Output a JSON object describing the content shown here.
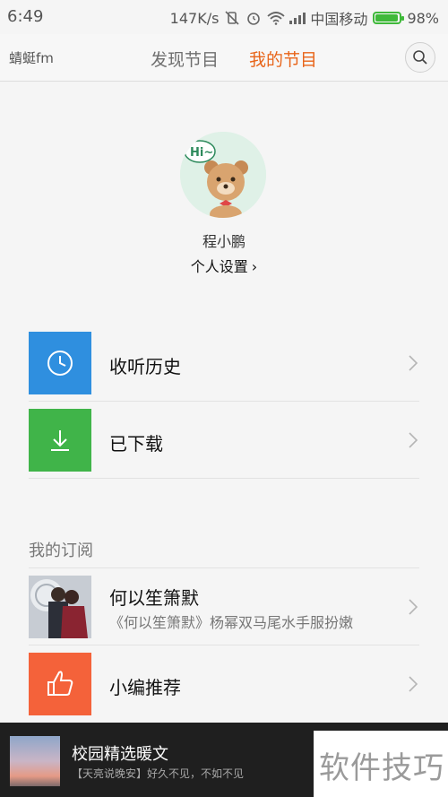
{
  "status_bar": {
    "time": "6:49",
    "speed": "147K/s",
    "carrier": "中国移动",
    "battery": "98%",
    "battery_level": 0.98,
    "battery_color": "#3fb93a"
  },
  "nav": {
    "logo": "蜻蜓fm",
    "tabs": [
      {
        "label": "发现节目",
        "active": false
      },
      {
        "label": "我的节目",
        "active": true
      }
    ],
    "active_color": "#e8651a",
    "search_icon": "search-icon"
  },
  "profile": {
    "avatar_text": "Hi~",
    "username": "程小鹏",
    "settings_label": "个人设置",
    "settings_chevron": "›"
  },
  "menu": [
    {
      "label": "收听历史",
      "icon": "clock-icon",
      "color": "#2f8fdf"
    },
    {
      "label": "已下载",
      "icon": "download-icon",
      "color": "#40b449"
    }
  ],
  "subscriptions": {
    "title": "我的订阅",
    "items": [
      {
        "title": "何以笙箫默",
        "subtitle": "《何以笙箫默》杨幂双马尾水手服扮嫩",
        "icon": "cover-image"
      },
      {
        "title": "小编推荐",
        "icon": "thumbs-up-icon",
        "color": "#f4623a"
      }
    ]
  },
  "player": {
    "title": "校园精选暖文",
    "subtitle": "【天亮说晚安】好久不见，不如不见"
  },
  "watermark": "软件技巧"
}
